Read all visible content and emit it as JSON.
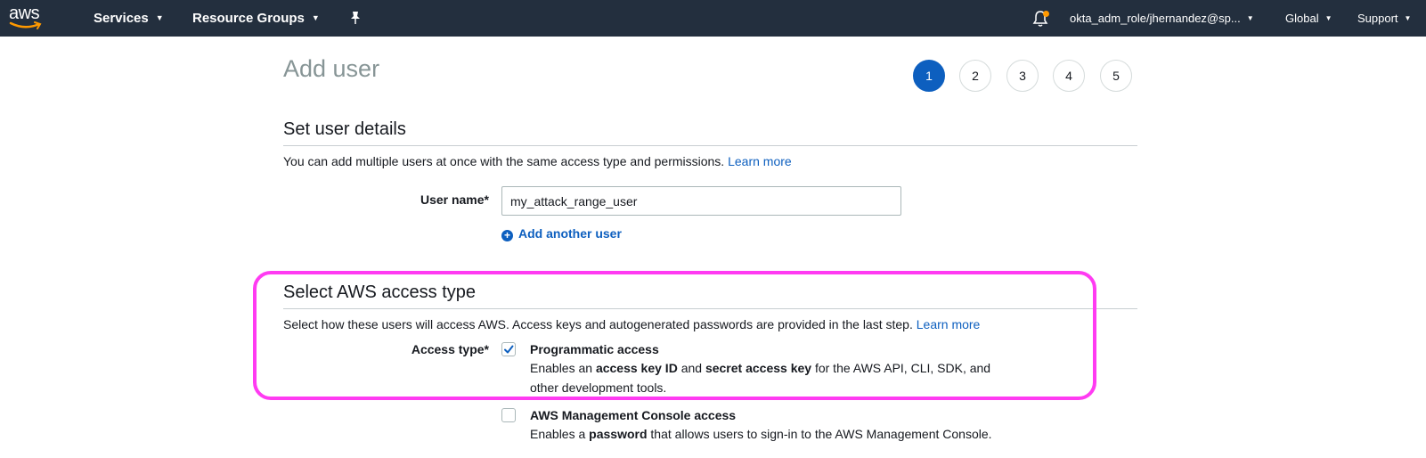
{
  "nav": {
    "logo": "aws",
    "services": "Services",
    "resource_groups": "Resource Groups",
    "account": "okta_adm_role/jhernandez@sp...",
    "region": "Global",
    "support": "Support"
  },
  "page": {
    "title": "Add user",
    "steps": [
      "1",
      "2",
      "3",
      "4",
      "5"
    ],
    "active_step": "1"
  },
  "user_details": {
    "title": "Set user details",
    "description": "You can add multiple users at once with the same access type and permissions.",
    "learn_more": "Learn more",
    "user_name_label": "User name*",
    "user_name_value": "my_attack_range_user",
    "add_another": "Add another user"
  },
  "access_type": {
    "title": "Select AWS access type",
    "description": "Select how these users will access AWS. Access keys and autogenerated passwords are provided in the last step.",
    "learn_more": "Learn more",
    "label": "Access type*",
    "options": [
      {
        "title": "Programmatic access",
        "checked": true,
        "desc_parts": [
          "Enables an ",
          "access key ID",
          " and ",
          "secret access key",
          " for the AWS API, CLI, SDK, and other development tools."
        ]
      },
      {
        "title": "AWS Management Console access",
        "checked": false,
        "desc_parts": [
          "Enables a ",
          "password",
          " that allows users to sign-in to the AWS Management Console."
        ]
      }
    ]
  },
  "colors": {
    "nav_bg": "#232f3e",
    "accent": "#0d5fbf",
    "highlight": "#ff3bf2",
    "notification_dot": "#ff9900"
  }
}
